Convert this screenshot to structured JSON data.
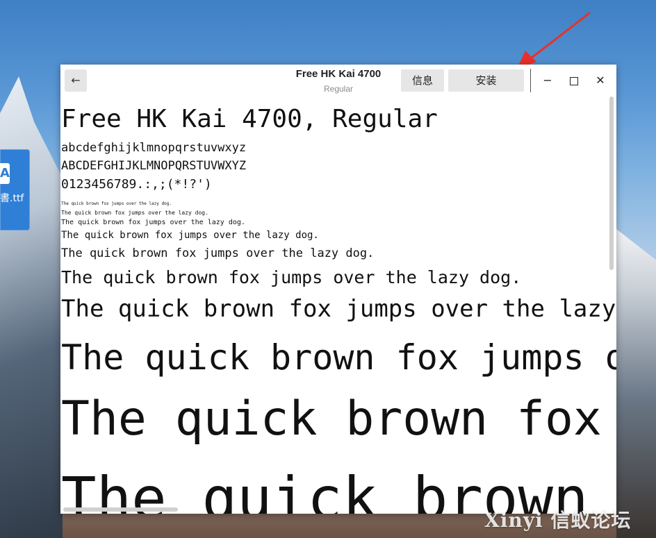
{
  "desktop": {
    "file_icon_glyph": "A",
    "file_label": "書.ttf",
    "watermark": "Xinyi 信蚁论坛"
  },
  "window": {
    "title": "Free HK Kai 4700",
    "subtitle": "Regular",
    "back_icon": "←",
    "info_button": "信息",
    "install_button": "安装",
    "min_icon": "−",
    "close_icon": "✕"
  },
  "preview": {
    "heading": "Free HK Kai 4700, Regular",
    "lowercase": "abcdefghijklmnopqrstuvwxyz",
    "uppercase": "ABCDEFGHIJKLMNOPQRSTUVWXYZ",
    "digits": "0123456789.:,;(*!?')",
    "samples": [
      "The quick brown fox jumps over the lazy dog.",
      "The quick brown fox jumps over the lazy dog.",
      "The quick brown fox jumps over the lazy dog.",
      "The quick brown fox jumps over the lazy dog.",
      "The quick brown fox jumps over the lazy dog.",
      "The quick brown fox jumps over the lazy dog.",
      "The quick brown fox jumps over the lazy dog.",
      "The quick brown fox jumps over the lazy dog.",
      "The quick brown fox jumps over the lazy dog.",
      "The quick brown fox jumps over the lazy dog."
    ]
  },
  "colors": {
    "arrow": "#e8312a",
    "file_icon": "#2f7fd6"
  }
}
